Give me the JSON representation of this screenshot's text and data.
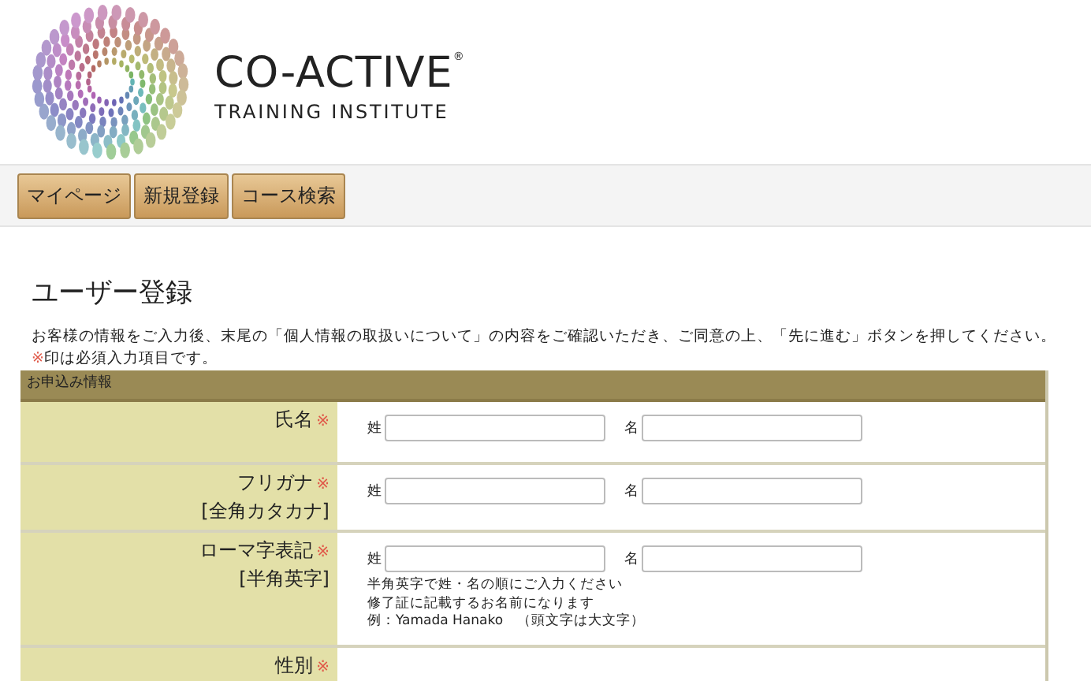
{
  "logo": {
    "name": "CO-ACTIVE$^{®}$",
    "subtitle": "TRAINING INSTITUTE"
  },
  "nav": [
    {
      "label": "マイページ"
    },
    {
      "label": "新規登録"
    },
    {
      "label": "コース検索"
    }
  ],
  "title": "ユーザー登録",
  "intro": "お客様の情報をご入力後、末尾の「個人情報の取扱いについて」の内容をご確認いただき、ご同意の上、「先に進む」ボタンを押してください。",
  "required_note": {
    "mark": "※",
    "text": "印は必須入力項目です。"
  },
  "form": {
    "header": "お申込み情報",
    "required_mark": "※",
    "rows": [
      {
        "label": "氏名",
        "required": true,
        "fields": [
          {
            "label": "姓"
          },
          {
            "label": "名"
          }
        ]
      },
      {
        "label": "フリガナ",
        "sublabel": "[全角カタカナ]",
        "required": true,
        "fields": [
          {
            "label": "姓"
          },
          {
            "label": "名"
          }
        ]
      },
      {
        "label": "ローマ字表記",
        "sublabel": "[半角英字]",
        "required": true,
        "fields": [
          {
            "label": "姓"
          },
          {
            "label": "名"
          }
        ],
        "notes": [
          "半角英字で姓・名の順にご入力ください",
          "修了証に記載するお名前になります",
          "例：Yamada Hanako　（頭文字は大文字）"
        ]
      },
      {
        "label": "性別",
        "required": true
      }
    ]
  }
}
